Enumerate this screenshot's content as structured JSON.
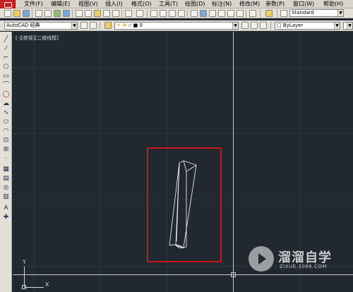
{
  "menubar": {
    "items": [
      {
        "label": "文件(F)"
      },
      {
        "label": "编辑(E)"
      },
      {
        "label": "视图(V)"
      },
      {
        "label": "插入(I)"
      },
      {
        "label": "格式(O)"
      },
      {
        "label": "工具(T)"
      },
      {
        "label": "绘图(D)"
      },
      {
        "label": "标注(N)"
      },
      {
        "label": "修改(M)"
      },
      {
        "label": "参数(P)"
      },
      {
        "label": "窗口(W)"
      },
      {
        "label": "帮助(H)"
      }
    ]
  },
  "toolbar": {
    "text_style": "Standard",
    "workspace": "AutoCAD 经典",
    "layer": "0",
    "color": "ByLayer"
  },
  "canvas": {
    "viewport_label": "[-][俯视][二维线框]",
    "ucs_y": "Y",
    "ucs_x": "X",
    "highlight_color": "#c81818",
    "background_color": "#212830"
  },
  "watermark": {
    "title": "溜溜自学",
    "url": "ZIXUE.3066.COM"
  }
}
